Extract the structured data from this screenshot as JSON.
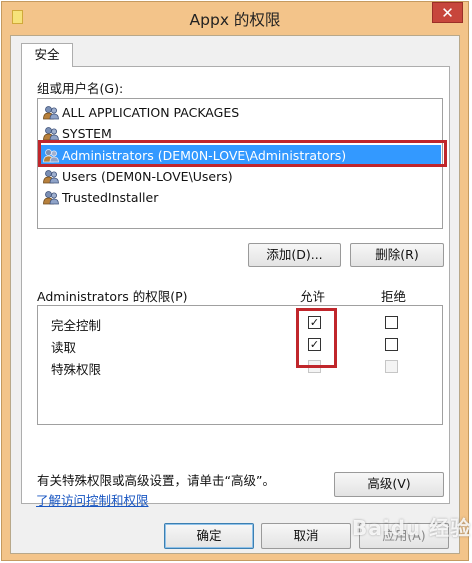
{
  "window": {
    "title": "Appx 的权限",
    "close_glyph": "✕"
  },
  "tabs": [
    {
      "label": "安全",
      "selected": true
    }
  ],
  "groups": {
    "label": "组或用户名(G):",
    "items": [
      {
        "name": "ALL APPLICATION PACKAGES",
        "icon": "users-icon"
      },
      {
        "name": "SYSTEM",
        "icon": "users-icon"
      },
      {
        "name": "Administrators (DEM0N-LOVE\\Administrators)",
        "icon": "users-icon",
        "selected": true
      },
      {
        "name": "Users (DEM0N-LOVE\\Users)",
        "icon": "users-icon"
      },
      {
        "name": "TrustedInstaller",
        "icon": "users-icon"
      }
    ]
  },
  "buttons": {
    "add": "添加(D)...",
    "remove": "删除(R)",
    "advanced": "高级(V)",
    "ok": "确定",
    "cancel": "取消",
    "apply": "应用(A)"
  },
  "permissions": {
    "header": "Administrators 的权限(P)",
    "allow_header": "允许",
    "deny_header": "拒绝",
    "rows": [
      {
        "name": "完全控制",
        "allow": true,
        "deny": false,
        "disabled": false
      },
      {
        "name": "读取",
        "allow": true,
        "deny": false,
        "disabled": false
      },
      {
        "name": "特殊权限",
        "allow": false,
        "deny": false,
        "disabled": true
      }
    ]
  },
  "special_note": "有关特殊权限或高级设置，请单击“高级”。",
  "help_link": "了解访问控制和权限",
  "watermark": "Baidu 经验",
  "colors": {
    "frame": "#f3c48a",
    "selection": "#3399ff",
    "highlight_box": "#c0262b",
    "link": "#1a57c2"
  }
}
